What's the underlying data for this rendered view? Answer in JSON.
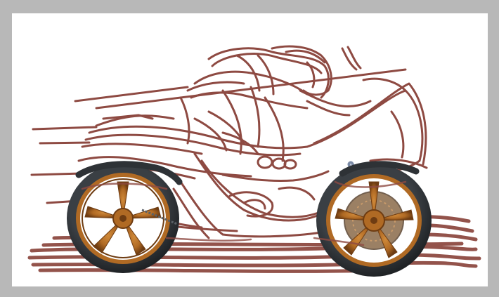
{
  "scene": {
    "subject": "motorcycle-rider-sketch-with-rendered-wheels",
    "colors": {
      "background": "#b8b8b8",
      "canvas": "#ffffff",
      "sketch": "#8e4a42",
      "tire": "#2e3236",
      "tire_highlight": "#5a6066",
      "rim": "#b06a24",
      "rim_dark": "#6e3c12",
      "fork": "#7a8aa6"
    }
  }
}
